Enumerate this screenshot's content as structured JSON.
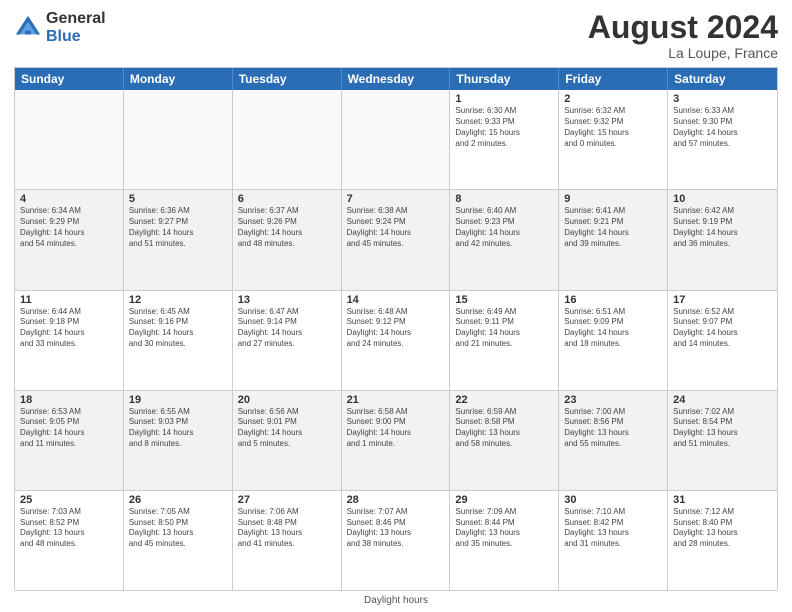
{
  "logo": {
    "general": "General",
    "blue": "Blue"
  },
  "title": "August 2024",
  "location": "La Loupe, France",
  "days_header": [
    "Sunday",
    "Monday",
    "Tuesday",
    "Wednesday",
    "Thursday",
    "Friday",
    "Saturday"
  ],
  "footer": "Daylight hours",
  "rows": [
    [
      {
        "day": "",
        "info": "",
        "empty": true
      },
      {
        "day": "",
        "info": "",
        "empty": true
      },
      {
        "day": "",
        "info": "",
        "empty": true
      },
      {
        "day": "",
        "info": "",
        "empty": true
      },
      {
        "day": "1",
        "info": "Sunrise: 6:30 AM\nSunset: 9:33 PM\nDaylight: 15 hours\nand 2 minutes."
      },
      {
        "day": "2",
        "info": "Sunrise: 6:32 AM\nSunset: 9:32 PM\nDaylight: 15 hours\nand 0 minutes."
      },
      {
        "day": "3",
        "info": "Sunrise: 6:33 AM\nSunset: 9:30 PM\nDaylight: 14 hours\nand 57 minutes."
      }
    ],
    [
      {
        "day": "4",
        "info": "Sunrise: 6:34 AM\nSunset: 9:29 PM\nDaylight: 14 hours\nand 54 minutes.",
        "shade": true
      },
      {
        "day": "5",
        "info": "Sunrise: 6:36 AM\nSunset: 9:27 PM\nDaylight: 14 hours\nand 51 minutes.",
        "shade": true
      },
      {
        "day": "6",
        "info": "Sunrise: 6:37 AM\nSunset: 9:26 PM\nDaylight: 14 hours\nand 48 minutes.",
        "shade": true
      },
      {
        "day": "7",
        "info": "Sunrise: 6:38 AM\nSunset: 9:24 PM\nDaylight: 14 hours\nand 45 minutes.",
        "shade": true
      },
      {
        "day": "8",
        "info": "Sunrise: 6:40 AM\nSunset: 9:23 PM\nDaylight: 14 hours\nand 42 minutes.",
        "shade": true
      },
      {
        "day": "9",
        "info": "Sunrise: 6:41 AM\nSunset: 9:21 PM\nDaylight: 14 hours\nand 39 minutes.",
        "shade": true
      },
      {
        "day": "10",
        "info": "Sunrise: 6:42 AM\nSunset: 9:19 PM\nDaylight: 14 hours\nand 36 minutes.",
        "shade": true
      }
    ],
    [
      {
        "day": "11",
        "info": "Sunrise: 6:44 AM\nSunset: 9:18 PM\nDaylight: 14 hours\nand 33 minutes."
      },
      {
        "day": "12",
        "info": "Sunrise: 6:45 AM\nSunset: 9:16 PM\nDaylight: 14 hours\nand 30 minutes."
      },
      {
        "day": "13",
        "info": "Sunrise: 6:47 AM\nSunset: 9:14 PM\nDaylight: 14 hours\nand 27 minutes."
      },
      {
        "day": "14",
        "info": "Sunrise: 6:48 AM\nSunset: 9:12 PM\nDaylight: 14 hours\nand 24 minutes."
      },
      {
        "day": "15",
        "info": "Sunrise: 6:49 AM\nSunset: 9:11 PM\nDaylight: 14 hours\nand 21 minutes."
      },
      {
        "day": "16",
        "info": "Sunrise: 6:51 AM\nSunset: 9:09 PM\nDaylight: 14 hours\nand 18 minutes."
      },
      {
        "day": "17",
        "info": "Sunrise: 6:52 AM\nSunset: 9:07 PM\nDaylight: 14 hours\nand 14 minutes."
      }
    ],
    [
      {
        "day": "18",
        "info": "Sunrise: 6:53 AM\nSunset: 9:05 PM\nDaylight: 14 hours\nand 11 minutes.",
        "shade": true
      },
      {
        "day": "19",
        "info": "Sunrise: 6:55 AM\nSunset: 9:03 PM\nDaylight: 14 hours\nand 8 minutes.",
        "shade": true
      },
      {
        "day": "20",
        "info": "Sunrise: 6:56 AM\nSunset: 9:01 PM\nDaylight: 14 hours\nand 5 minutes.",
        "shade": true
      },
      {
        "day": "21",
        "info": "Sunrise: 6:58 AM\nSunset: 9:00 PM\nDaylight: 14 hours\nand 1 minute.",
        "shade": true
      },
      {
        "day": "22",
        "info": "Sunrise: 6:59 AM\nSunset: 8:58 PM\nDaylight: 13 hours\nand 58 minutes.",
        "shade": true
      },
      {
        "day": "23",
        "info": "Sunrise: 7:00 AM\nSunset: 8:56 PM\nDaylight: 13 hours\nand 55 minutes.",
        "shade": true
      },
      {
        "day": "24",
        "info": "Sunrise: 7:02 AM\nSunset: 8:54 PM\nDaylight: 13 hours\nand 51 minutes.",
        "shade": true
      }
    ],
    [
      {
        "day": "25",
        "info": "Sunrise: 7:03 AM\nSunset: 8:52 PM\nDaylight: 13 hours\nand 48 minutes."
      },
      {
        "day": "26",
        "info": "Sunrise: 7:05 AM\nSunset: 8:50 PM\nDaylight: 13 hours\nand 45 minutes."
      },
      {
        "day": "27",
        "info": "Sunrise: 7:06 AM\nSunset: 8:48 PM\nDaylight: 13 hours\nand 41 minutes."
      },
      {
        "day": "28",
        "info": "Sunrise: 7:07 AM\nSunset: 8:46 PM\nDaylight: 13 hours\nand 38 minutes."
      },
      {
        "day": "29",
        "info": "Sunrise: 7:09 AM\nSunset: 8:44 PM\nDaylight: 13 hours\nand 35 minutes."
      },
      {
        "day": "30",
        "info": "Sunrise: 7:10 AM\nSunset: 8:42 PM\nDaylight: 13 hours\nand 31 minutes."
      },
      {
        "day": "31",
        "info": "Sunrise: 7:12 AM\nSunset: 8:40 PM\nDaylight: 13 hours\nand 28 minutes."
      }
    ]
  ]
}
